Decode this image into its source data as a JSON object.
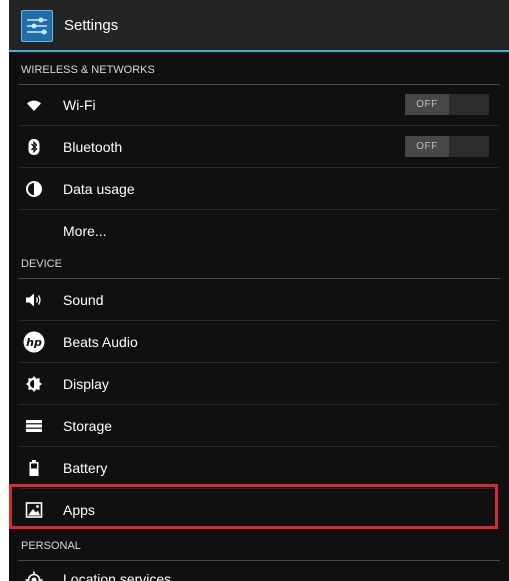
{
  "header": {
    "title": "Settings",
    "icon": "settings-sliders-icon"
  },
  "sections": {
    "wireless": "WIRELESS & NETWORKS",
    "device": "DEVICE",
    "personal": "PERSONAL"
  },
  "items": {
    "wifi": {
      "label": "Wi-Fi",
      "icon": "wifi-icon",
      "toggle": "OFF"
    },
    "bluetooth": {
      "label": "Bluetooth",
      "icon": "bluetooth-icon",
      "toggle": "OFF"
    },
    "data_usage": {
      "label": "Data usage",
      "icon": "data-usage-icon"
    },
    "more": {
      "label": "More..."
    },
    "sound": {
      "label": "Sound",
      "icon": "speaker-icon"
    },
    "beats": {
      "label": "Beats Audio",
      "icon": "hp-logo-icon"
    },
    "display": {
      "label": "Display",
      "icon": "brightness-icon"
    },
    "storage": {
      "label": "Storage",
      "icon": "storage-icon"
    },
    "battery": {
      "label": "Battery",
      "icon": "battery-icon"
    },
    "apps": {
      "label": "Apps",
      "icon": "apps-icon",
      "highlighted": true
    },
    "location": {
      "label": "Location services",
      "icon": "location-icon"
    }
  },
  "colors": {
    "accent": "#33b5e5",
    "highlight": "#d62a30",
    "background": "#101010"
  }
}
